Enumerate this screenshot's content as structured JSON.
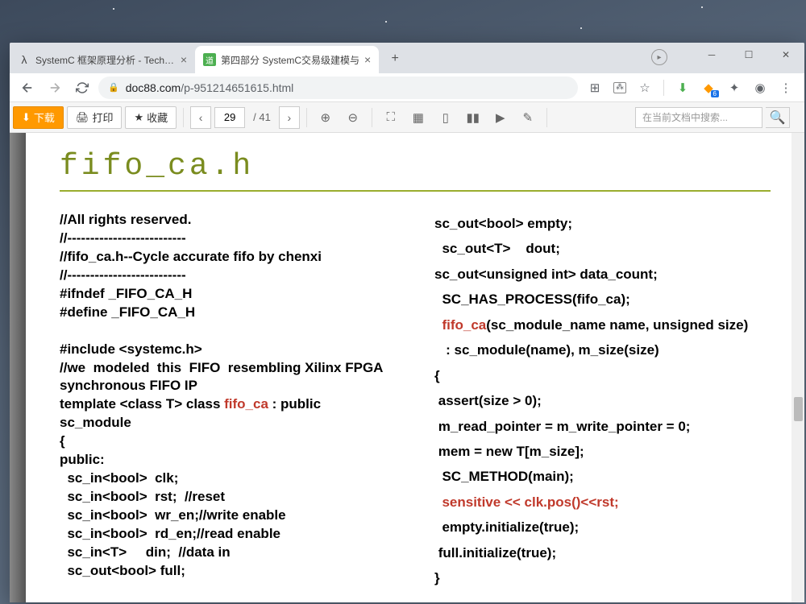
{
  "tabs": [
    {
      "icon": "λ",
      "label": "SystemC 框架原理分析 - Tech No"
    },
    {
      "icon": "道",
      "label": "第四部分 SystemC交易级建模与"
    }
  ],
  "url": {
    "domain": "doc88.com",
    "path": "/p-951214651615.html"
  },
  "ext_badge": "6",
  "toolbar": {
    "download": "下载",
    "print": "打印",
    "favorite": "收藏",
    "page_current": "29",
    "page_total": "/ 41",
    "search_placeholder": "在当前文档中搜索..."
  },
  "document": {
    "title": "fifo_ca.h",
    "left_column": [
      {
        "t": "//All rights reserved."
      },
      {
        "t": "//--------------------------"
      },
      {
        "t": "//fifo_ca.h--Cycle accurate fifo by chenxi"
      },
      {
        "t": "//--------------------------"
      },
      {
        "t": "#ifndef _FIFO_CA_H"
      },
      {
        "t": "#define _FIFO_CA_H"
      },
      {
        "t": ""
      },
      {
        "t": "#include <systemc.h>"
      },
      {
        "t": "//we  modeled  this  FIFO  resembling Xilinx FPGA synchronous FIFO IP"
      },
      {
        "mixed": [
          {
            "t": "template <class T> class "
          },
          {
            "t": "fifo_ca",
            "c": "r"
          },
          {
            "t": " : public sc_module"
          }
        ]
      },
      {
        "t": "{"
      },
      {
        "t": "public:"
      },
      {
        "t": "  sc_in<bool>  clk;"
      },
      {
        "t": "  sc_in<bool>  rst;  //reset"
      },
      {
        "t": "  sc_in<bool>  wr_en;//write enable"
      },
      {
        "t": "  sc_in<bool>  rd_en;//read enable"
      },
      {
        "t": "  sc_in<T>     din;  //data in"
      },
      {
        "t": "  sc_out<bool> full;"
      }
    ],
    "right_column": [
      {
        "t": "sc_out<bool> empty;"
      },
      {
        "t": "  sc_out<T>    dout;"
      },
      {
        "t": "sc_out<unsigned int> data_count;"
      },
      {
        "t": "  SC_HAS_PROCESS(fifo_ca);"
      },
      {
        "mixed": [
          {
            "t": "  "
          },
          {
            "t": "fifo_ca",
            "c": "r"
          },
          {
            "t": "(sc_module_name name, unsigned size)"
          }
        ]
      },
      {
        "t": "   : sc_module(name), m_size(size)"
      },
      {
        "t": "{"
      },
      {
        "t": " assert(size > 0);"
      },
      {
        "t": " m_read_pointer = m_write_pointer = 0;"
      },
      {
        "t": " mem = new T[m_size];"
      },
      {
        "t": "  SC_METHOD(main);"
      },
      {
        "t": "  sensitive << clk.pos()<<rst;",
        "c": "r"
      },
      {
        "t": "  empty.initialize(true);"
      },
      {
        "t": " full.initialize(true);"
      },
      {
        "t": "}"
      }
    ]
  }
}
